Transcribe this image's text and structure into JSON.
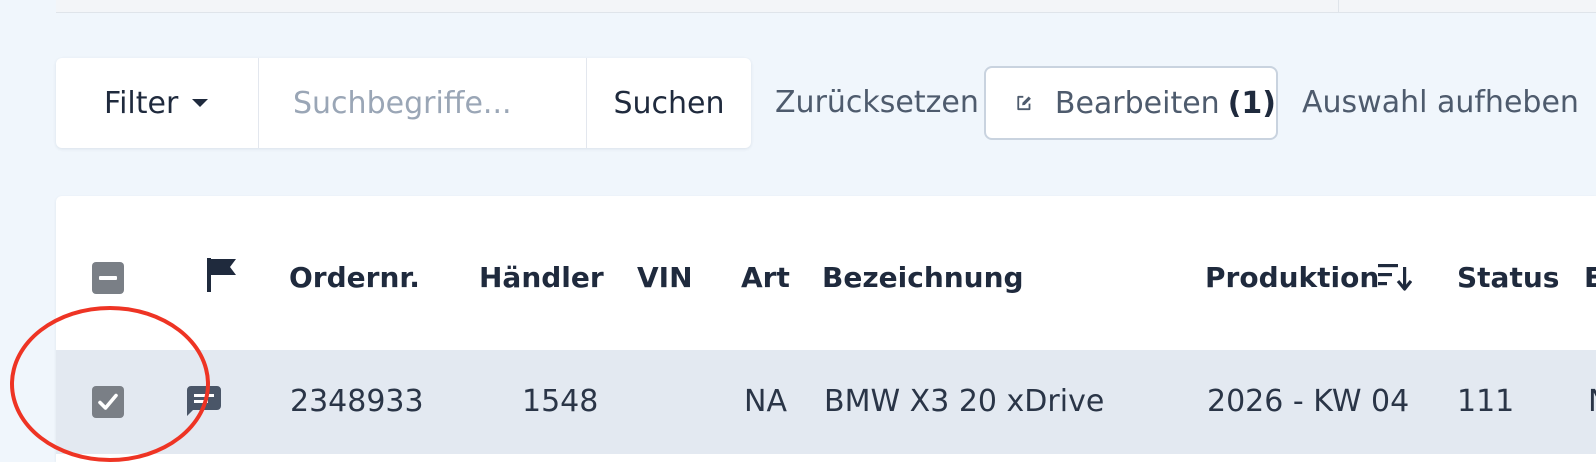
{
  "toolbar": {
    "filter_label": "Filter",
    "search_placeholder": "Suchbegriffe...",
    "search_value": "",
    "search_button": "Suchen",
    "reset_label": "Zurücksetzen",
    "edit_label": "Bearbeiten",
    "edit_count": "(1)",
    "deselect_label": "Auswahl aufheben"
  },
  "table": {
    "headers": {
      "flag_icon": "flag-icon",
      "order": "Ordernr.",
      "dealer": "Händler",
      "vin": "VIN",
      "type": "Art",
      "description": "Bezeichnung",
      "production": "Produktion",
      "status": "Status",
      "next": "E"
    },
    "rows": [
      {
        "selected": true,
        "note_icon": "comment-icon",
        "order": "2348933",
        "dealer": "1548",
        "vin": "",
        "type": "NA",
        "description": "BMW X3 20 xDrive",
        "production": "2026 - KW 04",
        "status": "111",
        "next": "N"
      }
    ]
  },
  "colors": {
    "background": "#f0f6fc",
    "row_selected": "#e3e9f1",
    "checkbox": "#7a7f86",
    "annotation": "#ee3424",
    "text_primary": "#1f2a3d"
  }
}
